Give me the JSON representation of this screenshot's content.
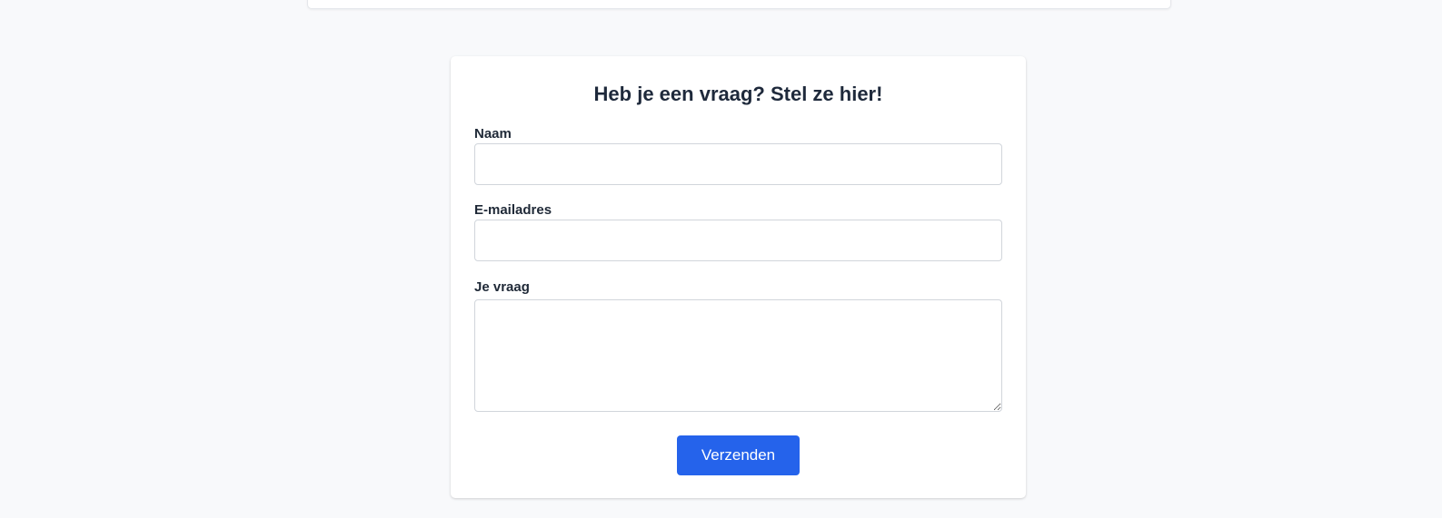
{
  "form": {
    "title": "Heb je een vraag? Stel ze hier!",
    "fields": [
      {
        "label": "Naam",
        "value": ""
      },
      {
        "label": "E-mailadres",
        "value": ""
      },
      {
        "label": "Je vraag",
        "value": ""
      }
    ],
    "submit_label": "Verzenden"
  },
  "colors": {
    "page_background": "#f8f9fb",
    "card_background": "#ffffff",
    "primary_button": "#2563eb",
    "heading_text": "#1e293b",
    "input_border": "#d1d5db"
  }
}
